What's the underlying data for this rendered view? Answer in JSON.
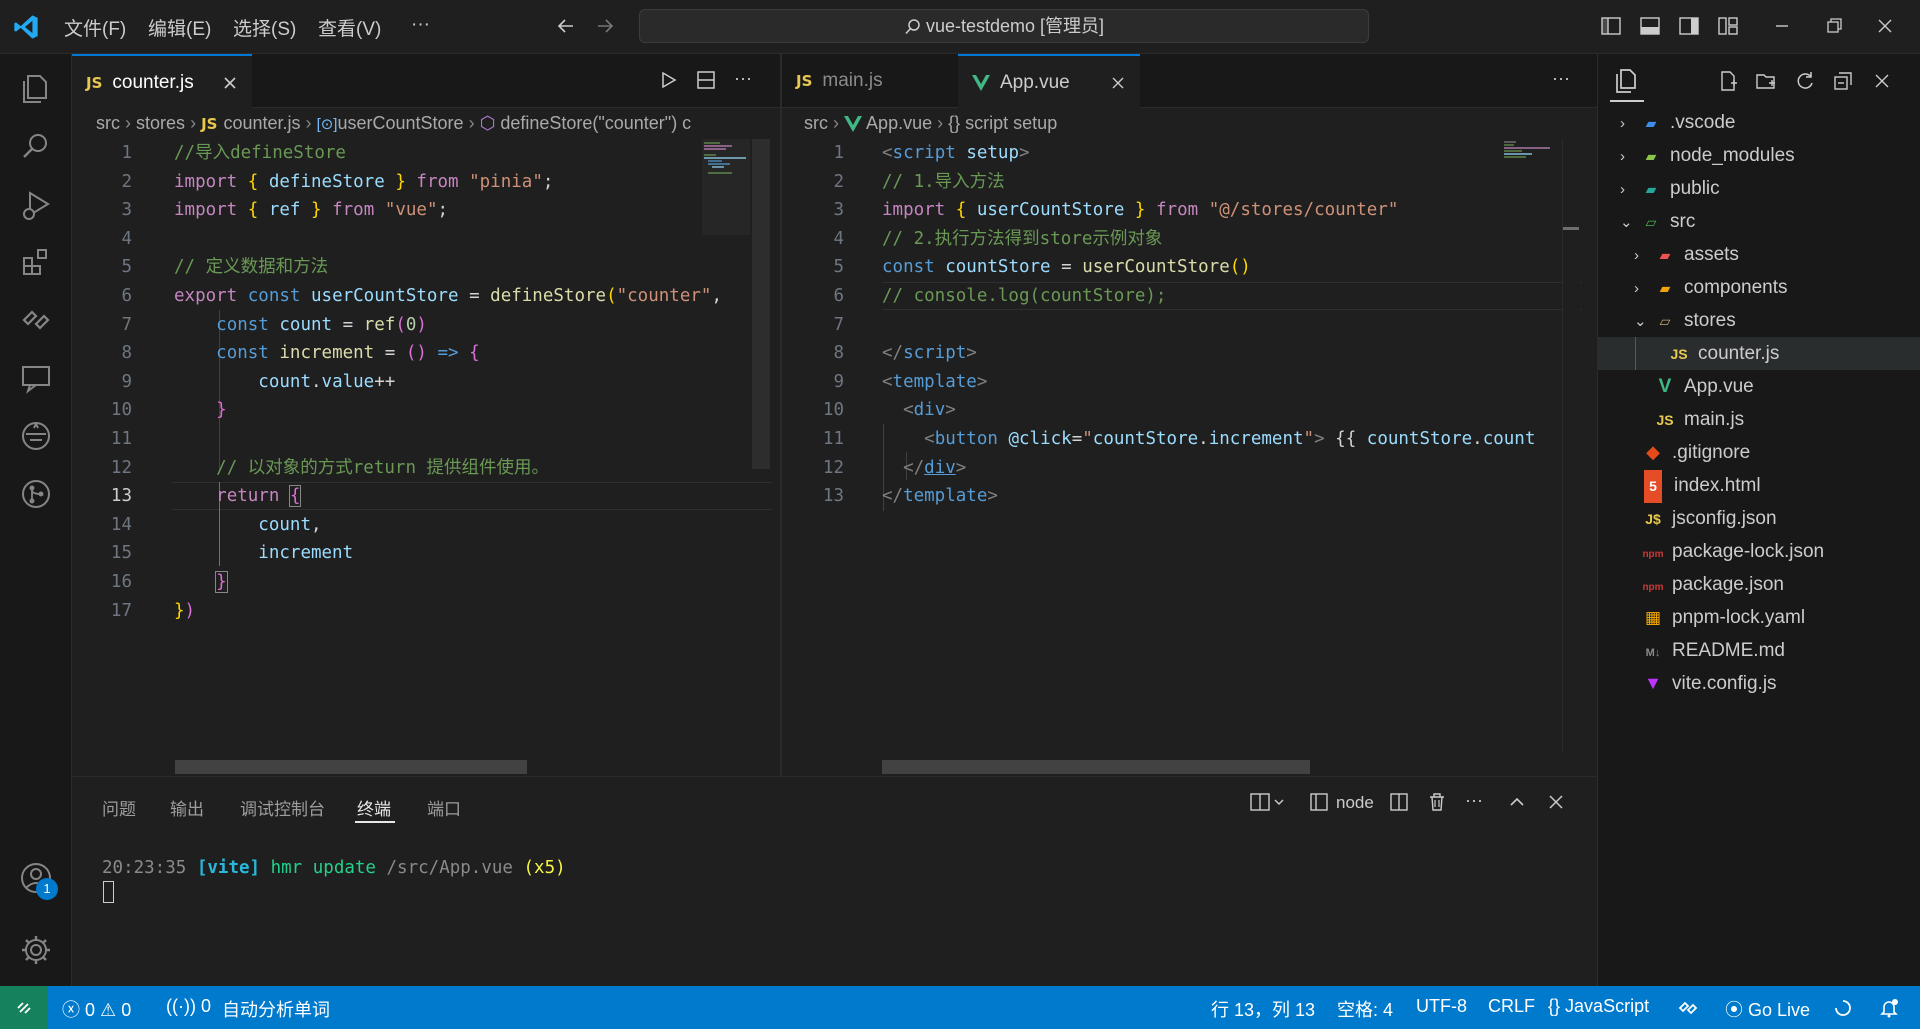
{
  "titlebar": {
    "menus": [
      "文件(F)",
      "编辑(E)",
      "选择(S)",
      "查看(V)",
      "···"
    ],
    "search": "vue-testdemo [管理员]"
  },
  "left_editor": {
    "tab_label": "counter.js",
    "breadcrumb": [
      "src",
      "stores",
      "counter.js",
      "userCountStore",
      "defineStore(\"counter\") c"
    ],
    "line_numbers": [
      "1",
      "2",
      "3",
      "4",
      "5",
      "6",
      "7",
      "8",
      "9",
      "10",
      "11",
      "12",
      "13",
      "14",
      "15",
      "16",
      "17"
    ]
  },
  "right_editor": {
    "tabs": [
      "main.js",
      "App.vue"
    ],
    "breadcrumb": [
      "src",
      "App.vue",
      "{} script setup"
    ],
    "line_numbers": [
      "1",
      "2",
      "3",
      "4",
      "5",
      "6",
      "7",
      "8",
      "9",
      "10",
      "11",
      "12",
      "13"
    ]
  },
  "explorer": {
    "items": [
      {
        "label": ".vscode",
        "kind": "folder"
      },
      {
        "label": "node_modules",
        "kind": "folder"
      },
      {
        "label": "public",
        "kind": "folder"
      },
      {
        "label": "src",
        "kind": "folder-open"
      },
      {
        "label": "assets",
        "kind": "folder"
      },
      {
        "label": "components",
        "kind": "folder"
      },
      {
        "label": "stores",
        "kind": "folder-open"
      },
      {
        "label": "counter.js",
        "kind": "js"
      },
      {
        "label": "App.vue",
        "kind": "vue"
      },
      {
        "label": "main.js",
        "kind": "js"
      },
      {
        "label": ".gitignore",
        "kind": "git"
      },
      {
        "label": "index.html",
        "kind": "html"
      },
      {
        "label": "jsconfig.json",
        "kind": "json"
      },
      {
        "label": "package-lock.json",
        "kind": "npm"
      },
      {
        "label": "package.json",
        "kind": "npm"
      },
      {
        "label": "pnpm-lock.yaml",
        "kind": "pnpm"
      },
      {
        "label": "README.md",
        "kind": "md"
      },
      {
        "label": "vite.config.js",
        "kind": "vite"
      }
    ]
  },
  "panel": {
    "tabs": [
      "问题",
      "输出",
      "调试控制台",
      "终端",
      "端口"
    ],
    "active_tab": "终端",
    "terminal_name": "node",
    "terminal_time": "20:23:35",
    "terminal_tag": "[vite]",
    "terminal_msg": "hmr update",
    "terminal_path": "/src/App.vue",
    "terminal_count": "(x5)"
  },
  "statusbar": {
    "errors": "0",
    "warnings": "0",
    "ports": "0",
    "autodetect": "自动分析单词",
    "position": "行 13，列 13",
    "spaces": "空格: 4",
    "encoding": "UTF-8",
    "eol": "CRLF",
    "language": "JavaScript",
    "golive": "Go Live"
  },
  "accounts_badge": "1",
  "colors": {
    "statusbar": "#007acc",
    "keyword": "#569cd6",
    "control": "#c586c0",
    "function": "#dcdcaa",
    "string": "#ce9178",
    "comment": "#6a9955"
  }
}
